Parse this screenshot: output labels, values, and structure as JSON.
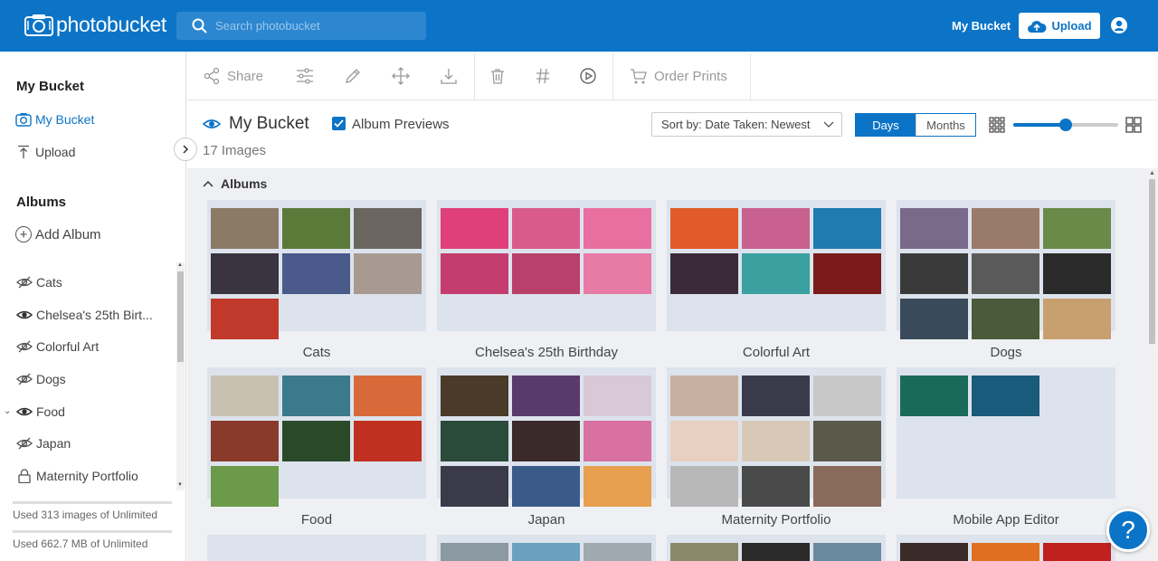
{
  "brand": {
    "name": "photobucket"
  },
  "search": {
    "placeholder": "Search photobucket"
  },
  "topnav": {
    "my_bucket": "My Bucket",
    "upload": "Upload"
  },
  "sidebar": {
    "title": "My Bucket",
    "links": [
      {
        "label": "My Bucket",
        "active": true
      },
      {
        "label": "Upload",
        "active": false
      }
    ],
    "albums_title": "Albums",
    "add_album": "Add Album",
    "albums": [
      {
        "name": "Cats",
        "visible": false
      },
      {
        "name": "Chelsea's 25th Birt...",
        "visible": true
      },
      {
        "name": "Colorful Art",
        "visible": false
      },
      {
        "name": "Dogs",
        "visible": false
      },
      {
        "name": "Food",
        "visible": true,
        "expandable": true
      },
      {
        "name": "Japan",
        "visible": false
      },
      {
        "name": "Maternity Portfolio",
        "visible": false,
        "locked": true
      }
    ],
    "usage_images": "Used 313 images of Unlimited",
    "usage_storage": "Used 662.7 MB of Unlimited"
  },
  "toolbar": {
    "share": "Share",
    "order_prints": "Order Prints"
  },
  "header": {
    "title": "My Bucket",
    "album_previews": "Album Previews",
    "count": "17 Images",
    "sort": "Sort by: Date Taken: Newest",
    "view_days": "Days",
    "view_months": "Months",
    "zoom_level": 0.5
  },
  "content": {
    "section_title": "Albums",
    "albums": [
      {
        "name": "Cats",
        "colors": [
          "#8a7a66",
          "#5b7a3a",
          "#6b6560",
          "#3a3340",
          "#4a5a8a",
          "#a89a90",
          "#c0392b"
        ]
      },
      {
        "name": "Chelsea's 25th Birthday",
        "colors": [
          "#e0407a",
          "#d95a8c",
          "#e86fa0",
          "#c53d6e",
          "#b8406a",
          "#e87aa6"
        ]
      },
      {
        "name": "Colorful Art",
        "colors": [
          "#e05a2a",
          "#c86090",
          "#1f7bb0",
          "#3a2a3a",
          "#3aa0a0",
          "#7a1a1a"
        ]
      },
      {
        "name": "Dogs",
        "colors": [
          "#7a6a8a",
          "#9a7a6a",
          "#6a8a4a",
          "#3a3a3a",
          "#5a5a5a",
          "#2a2a2a",
          "#3a4a5a",
          "#4a5a3a",
          "#c8a070"
        ]
      },
      {
        "name": "Food",
        "colors": [
          "#c8c0b0",
          "#3a7a8a",
          "#d86a3a",
          "#8a3a2a",
          "#2a4a2a",
          "#c03020",
          "#6a9a4a"
        ]
      },
      {
        "name": "Japan",
        "colors": [
          "#4a3a2a",
          "#5a3a6a",
          "#d8c8d8",
          "#2a4a3a",
          "#3a2a2a",
          "#d870a0",
          "#3a3a4a",
          "#3a5a8a",
          "#e8a050"
        ]
      },
      {
        "name": "Maternity Portfolio",
        "colors": [
          "#c8b0a0",
          "#3a3a4a",
          "#c8c8c8",
          "#e8d0c0",
          "#d8c8b8",
          "#5a5a4a",
          "#b8b8b8",
          "#4a4a4a",
          "#8a6a5a"
        ]
      },
      {
        "name": "Mobile App Editor",
        "colors": [
          "#1a6a5a",
          "#1a5a7a"
        ]
      }
    ],
    "row3_colors": [
      [],
      [
        "#8a9aa0",
        "#6aa0c0",
        "#a0a8b0"
      ],
      [
        "#8a8a6a",
        "#2a2a2a",
        "#6a8aa0"
      ],
      [
        "#3a2a2a",
        "#e07020",
        "#c02020"
      ]
    ]
  },
  "help": "?"
}
